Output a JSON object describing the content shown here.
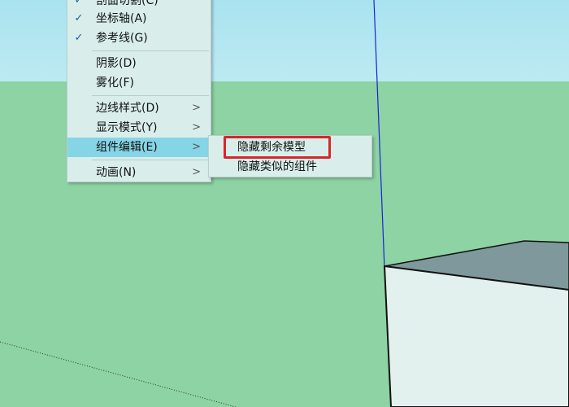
{
  "view_menu": {
    "items": [
      {
        "label": "剖面切割(C)",
        "checked": true,
        "submenu": false
      },
      {
        "label": "坐标轴(A)",
        "checked": true,
        "submenu": false
      },
      {
        "label": "参考线(G)",
        "checked": true,
        "submenu": false
      },
      {
        "label": "阴影(D)",
        "checked": false,
        "submenu": false
      },
      {
        "label": "雾化(F)",
        "checked": false,
        "submenu": false
      },
      {
        "label": "边线样式(D)",
        "checked": false,
        "submenu": true
      },
      {
        "label": "显示模式(Y)",
        "checked": false,
        "submenu": true
      },
      {
        "label": "组件编辑(E)",
        "checked": false,
        "submenu": true,
        "highlighted": true
      },
      {
        "label": "动画(N)",
        "checked": false,
        "submenu": true
      }
    ],
    "check_glyph": "✓",
    "arrow_glyph": ">",
    "highlight_color": "#86d5e6",
    "menu_bg": "#d9eeeb"
  },
  "component_edit_submenu": {
    "items": [
      {
        "label": "隐藏剩余模型",
        "emphasized": true
      },
      {
        "label": "隐藏类似的组件",
        "emphasized": false
      }
    ],
    "emphasis_color": "#d8252a"
  },
  "viewport": {
    "sky_color": "#b5e7f1",
    "ground_color": "#8dd3a3",
    "box_front_color": "#e2f0ee",
    "box_top_color": "#7f989b",
    "axis_color": "#1a22d8"
  }
}
